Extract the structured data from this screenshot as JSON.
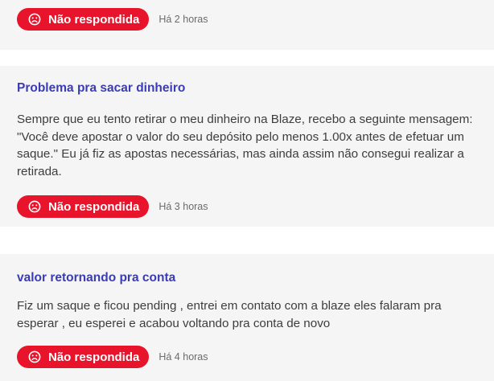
{
  "colors": {
    "title": "#3a3cb4",
    "badge_bg": "#e8142b",
    "badge_text": "#ffffff",
    "card_bg": "#f5f5f5",
    "body_text": "#3d3d3d",
    "time_text": "#6b6b6b"
  },
  "complaints": [
    {
      "status": {
        "icon": "sad-face-icon",
        "label": "Não respondida"
      },
      "time": "Há 2 horas"
    },
    {
      "title": "Problema pra sacar dinheiro",
      "body": "Sempre que eu tento retirar o meu dinheiro na Blaze, recebo a seguinte mensagem: \"Você deve apostar o valor do seu depósito pelo menos 1.00x antes de efetuar um saque.\" Eu já fiz as apostas necessárias, mas ainda assim não consegui realizar a retirada.",
      "status": {
        "icon": "sad-face-icon",
        "label": "Não respondida"
      },
      "time": "Há 3 horas"
    },
    {
      "title": "valor retornando pra conta",
      "body": "Fiz um saque e ficou pending , entrei em contato com a blaze eles falaram pra esperar , eu esperei e acabou voltando pra conta de novo",
      "status": {
        "icon": "sad-face-icon",
        "label": "Não respondida"
      },
      "time": "Há 4 horas"
    }
  ]
}
